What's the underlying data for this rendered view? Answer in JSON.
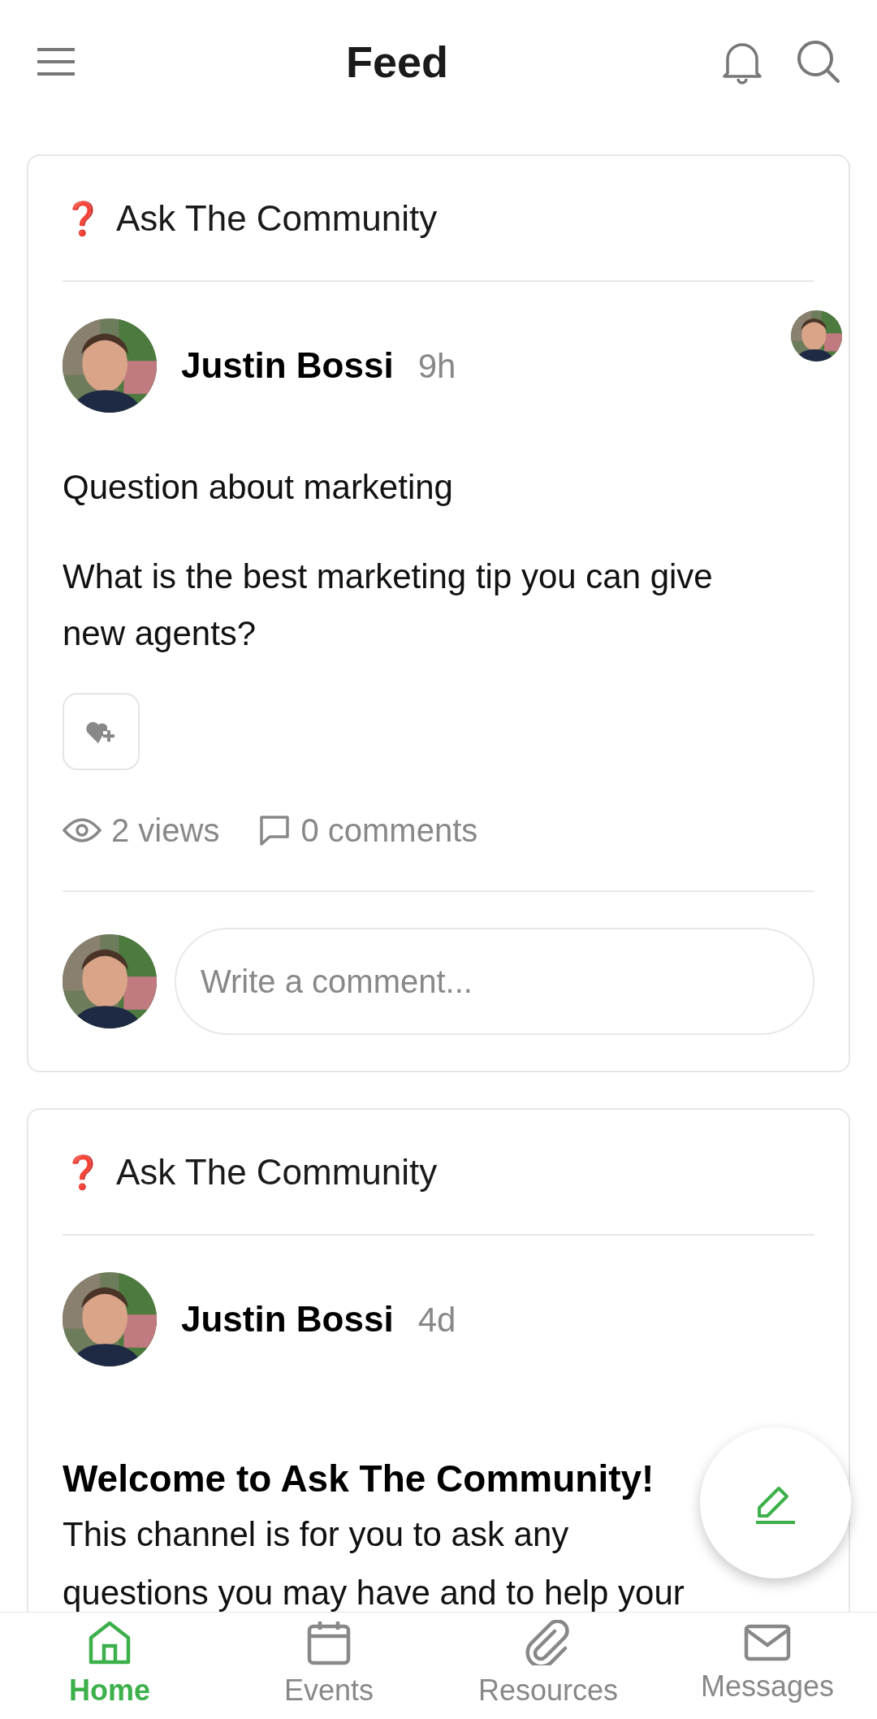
{
  "header": {
    "title": "Feed"
  },
  "posts": [
    {
      "channel_icon": "❓",
      "channel": "Ask The Community",
      "author": "Justin Bossi",
      "time": "9h",
      "seen_by_avatar": true,
      "title": "Question about marketing",
      "body": [
        "What is the best marketing tip you can give new agents?"
      ],
      "reaction_button": true,
      "views": "2 views",
      "comments": "0 comments",
      "comment_placeholder": "Write a comment..."
    },
    {
      "channel_icon": "❓",
      "channel": "Ask The Community",
      "author": "Justin Bossi",
      "time": "4d",
      "seen_by_avatar": false,
      "heading": "Welcome to Ask The Community!",
      "body": [
        "This channel is for you to ask any",
        "questions you may have and to help your"
      ]
    }
  ],
  "nav": [
    {
      "label": "Home",
      "kind": "home",
      "selected": true
    },
    {
      "label": "Events",
      "kind": "calendar",
      "selected": false
    },
    {
      "label": "Resources",
      "kind": "paperclip",
      "selected": false
    },
    {
      "label": "Messages",
      "kind": "mail",
      "selected": false
    }
  ]
}
